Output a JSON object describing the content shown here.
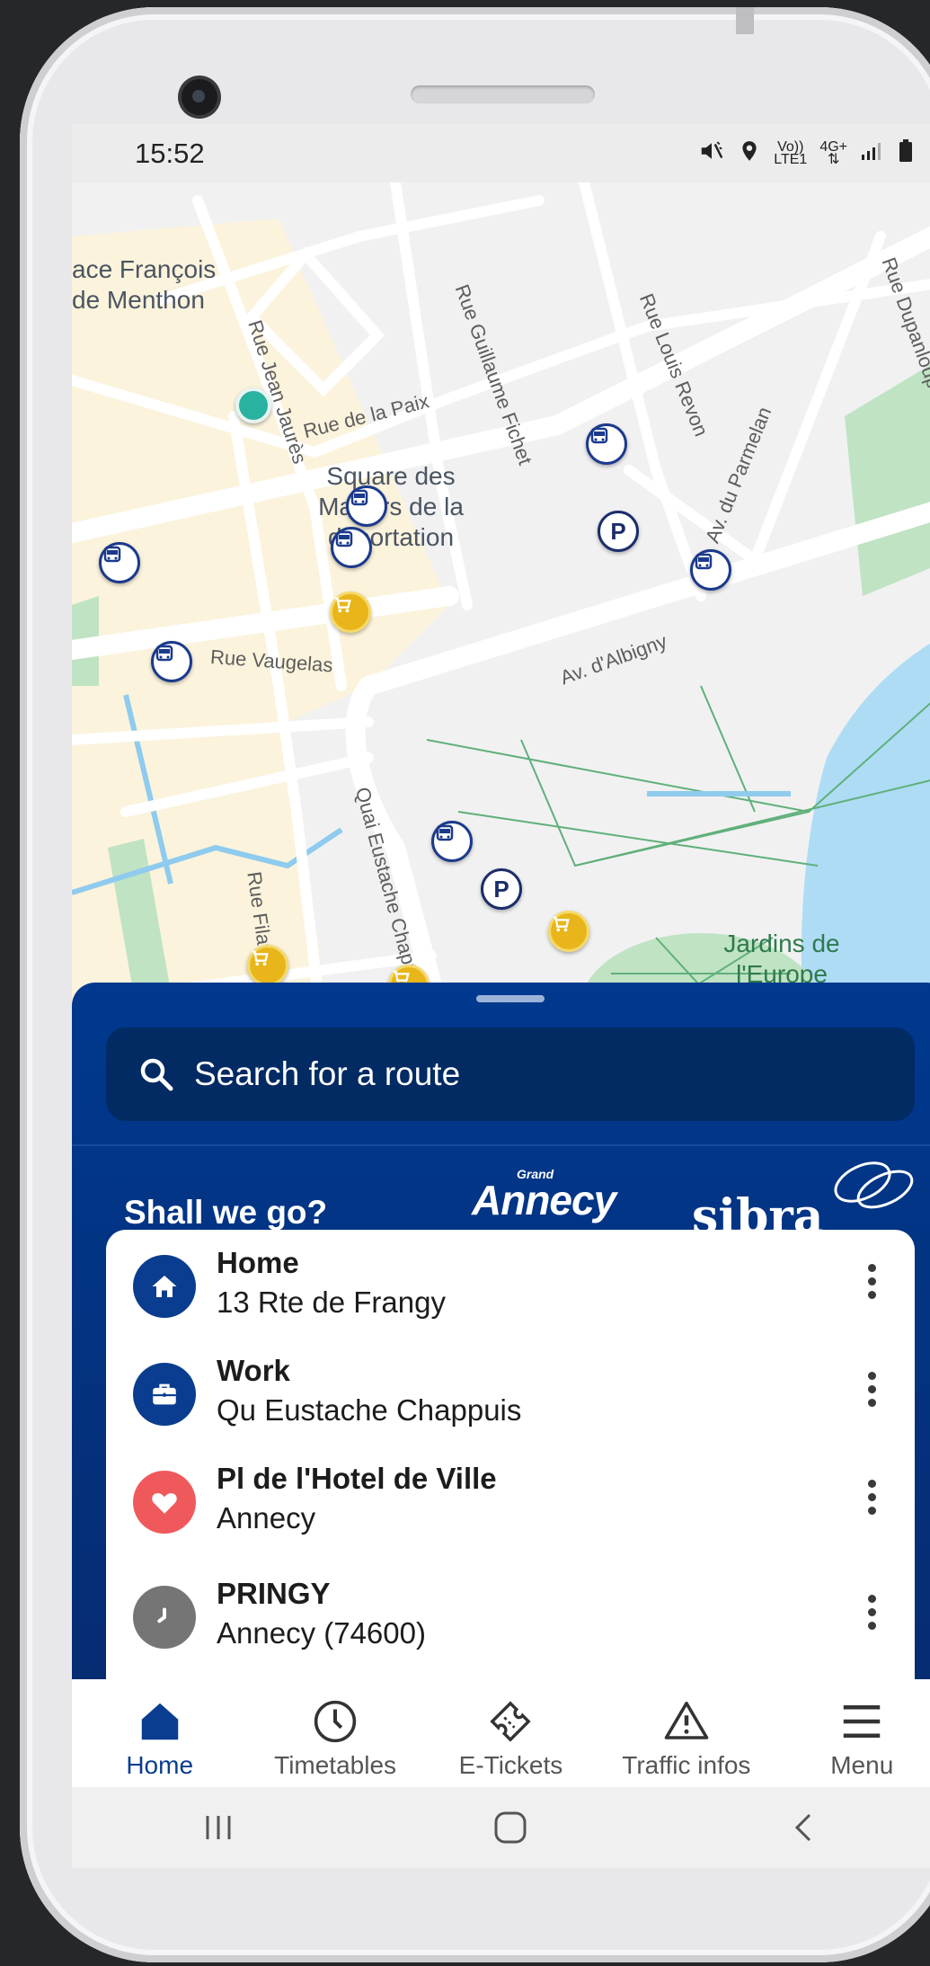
{
  "status": {
    "time": "15:52",
    "network_top": "Vo))",
    "network_bottom": "LTE1",
    "data_type": "4G+"
  },
  "map": {
    "street_labels": [
      "Rue Jean Jaurès",
      "Rue Guillaume Fichet",
      "Rue Louis Revon",
      "Rue Dupanloup",
      "Av. du Parmelan",
      "Rue de la Paix",
      "Av. d'Albigny",
      "Rue Vaugelas",
      "Quai Eustache Chappuis",
      "Rue Filaterie"
    ],
    "place_francois": "ace François\nde Menthon",
    "square": "Square des\nMartyrs de la\ndéportation",
    "jardins": "Jardins de\nl'Europe"
  },
  "sheet": {
    "search_placeholder": "Search for a route",
    "greeting": "Shall we go?",
    "logo_annecy_small": "Grand",
    "logo_annecy": "Annecy",
    "logo_sibra": "sibra",
    "favorites": [
      {
        "title": "Home",
        "subtitle": "13 Rte de Frangy",
        "icon": "home-icon",
        "color": "#0a3d8f"
      },
      {
        "title": "Work",
        "subtitle": "Qu Eustache Chappuis",
        "icon": "briefcase-icon",
        "color": "#0a3d8f"
      },
      {
        "title": "Pl de l'Hotel de Ville",
        "subtitle": "Annecy",
        "icon": "heart-icon",
        "color": "#f0595c"
      },
      {
        "title": "PRINGY",
        "subtitle": "Annecy (74600)",
        "icon": "clock-icon",
        "color": "#757575"
      }
    ]
  },
  "tabs": [
    {
      "label": "Home",
      "icon": "home-icon",
      "active": true
    },
    {
      "label": "Timetables",
      "icon": "clock-icon"
    },
    {
      "label": "E-Tickets",
      "icon": "ticket-icon"
    },
    {
      "label": "Traffic infos",
      "icon": "warning-icon"
    },
    {
      "label": "Menu",
      "icon": "hamburger-icon"
    }
  ],
  "colors": {
    "brand": "#00398f",
    "accent_heart": "#f0595c",
    "water": "#aedcf5",
    "park": "#bfe3c3"
  }
}
